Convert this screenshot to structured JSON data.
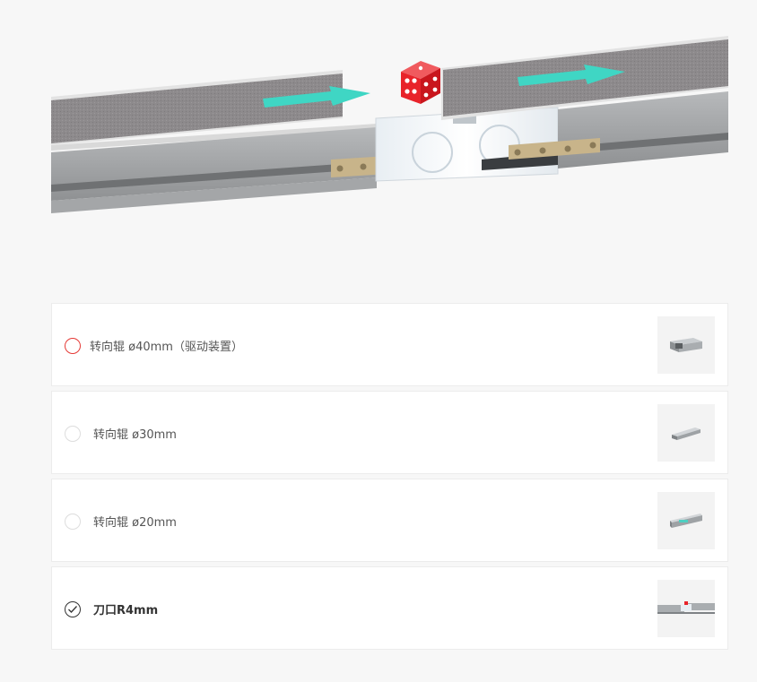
{
  "options": [
    {
      "label": "转向辊 ø40mm（驱动装置）",
      "state": "active",
      "thumb_icon": "roller-40mm-icon"
    },
    {
      "label": "转向辊 ø30mm",
      "state": "default",
      "thumb_icon": "roller-30mm-icon"
    },
    {
      "label": "转向辊 ø20mm",
      "state": "default",
      "thumb_icon": "roller-20mm-icon"
    },
    {
      "label": "刀口R4mm",
      "state": "checked",
      "thumb_icon": "knife-edge-r4mm-icon"
    }
  ],
  "colors": {
    "active_ring": "#e53935",
    "arrow": "#3fd6c4",
    "die": "#e8232a"
  }
}
